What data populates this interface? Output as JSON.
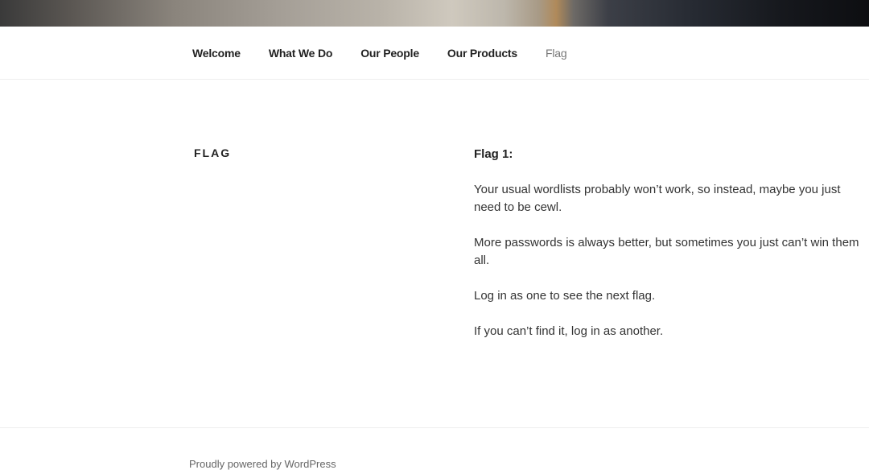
{
  "nav": {
    "items": [
      {
        "label": "Welcome"
      },
      {
        "label": "What We Do"
      },
      {
        "label": "Our People"
      },
      {
        "label": "Our Products"
      },
      {
        "label": "Flag"
      }
    ]
  },
  "page": {
    "title": "FLAG"
  },
  "entry": {
    "heading": "Flag 1:",
    "paragraphs": [
      "Your usual wordlists probably won’t work, so instead, maybe you just need to be cewl.",
      "More passwords is always better, but sometimes you just can’t win them all.",
      "Log in as one to see the next flag.",
      "If you can’t find it, log in as another."
    ]
  },
  "footer": {
    "credit": "Proudly powered by WordPress"
  }
}
